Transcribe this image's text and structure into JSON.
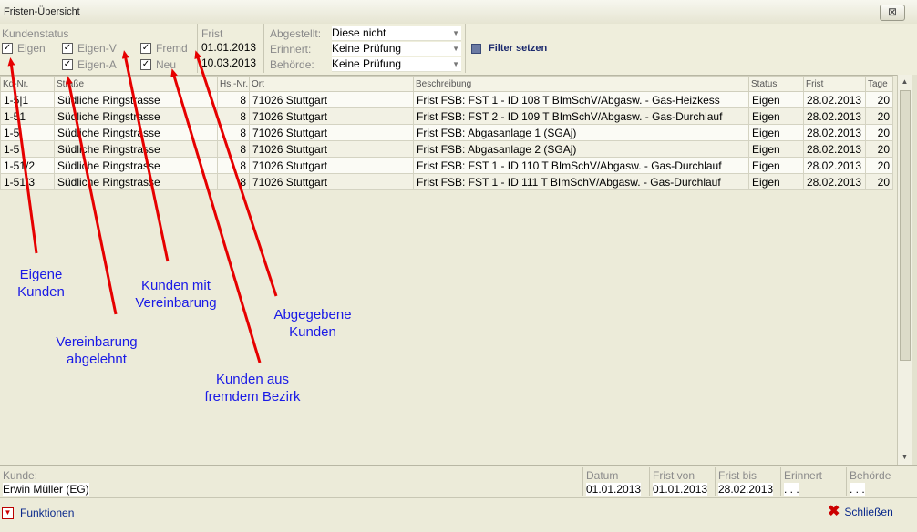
{
  "window": {
    "title": "Fristen-Übersicht",
    "close_label": "⊠"
  },
  "filter": {
    "kundenstatus_label": "Kundenstatus",
    "checkboxes": [
      {
        "label": "Eigen",
        "checked": true
      },
      {
        "label": "Eigen-V",
        "checked": true
      },
      {
        "label": "Fremd",
        "checked": true
      },
      {
        "label": "Eigen-A",
        "checked": true
      },
      {
        "label": "Neu",
        "checked": true
      }
    ],
    "frist_label": "Frist",
    "frist_from": "01.01.2013",
    "frist_to": "10.03.2013",
    "abgestellt_label": "Abgestellt:",
    "abgestellt_value": "Diese nicht",
    "erinnert_label": "Erinnert:",
    "erinnert_value": "Keine Prüfung",
    "behoerde_label": "Behörde:",
    "behoerde_value": "Keine Prüfung",
    "filter_button": "Filter setzen",
    "checkmark": "✓",
    "dropdown_arrow": "▼"
  },
  "table": {
    "columns": [
      "Kd-Nr.",
      "Straße",
      "Hs.-Nr.",
      "Ort",
      "Beschreibung",
      "Status",
      "Frist",
      "Tage"
    ],
    "rows": [
      [
        "1-5|1",
        "Südliche Ringstrasse",
        "8",
        "71026 Stuttgart",
        "Frist FSB: FST 1 - ID 108 T BImSchV/Abgasw. - Gas-Heizkess",
        "Eigen",
        "28.02.2013",
        "20"
      ],
      [
        "1-51",
        "Südliche Ringstrasse",
        "8",
        "71026 Stuttgart",
        "Frist FSB: FST 2 - ID 109 T BImSchV/Abgasw. - Gas-Durchlauf",
        "Eigen",
        "28.02.2013",
        "20"
      ],
      [
        "1-5",
        "Südliche Ringstrasse",
        "8",
        "71026 Stuttgart",
        "Frist FSB: Abgasanlage 1 (SGAj)",
        "Eigen",
        "28.02.2013",
        "20"
      ],
      [
        "1-5",
        "Südliche Ringstrasse",
        "8",
        "71026 Stuttgart",
        "Frist FSB: Abgasanlage 2 (SGAj)",
        "Eigen",
        "28.02.2013",
        "20"
      ],
      [
        "1-51/2",
        "Südliche Ringstrasse",
        "8",
        "71026 Stuttgart",
        "Frist FSB: FST 1 - ID 110 T BImSchV/Abgasw. - Gas-Durchlauf",
        "Eigen",
        "28.02.2013",
        "20"
      ],
      [
        "1-51/3",
        "Südliche Ringstrasse",
        "8",
        "71026 Stuttgart",
        "Frist FSB: FST 1 - ID 111 T BImSchV/Abgasw. - Gas-Durchlauf",
        "Eigen",
        "28.02.2013",
        "20"
      ]
    ]
  },
  "scroll": {
    "up": "▲",
    "down": "▼"
  },
  "bottom": {
    "kunde_label": "Kunde:",
    "kunde_value": "Erwin Müller (EG)",
    "datum_label": "Datum",
    "datum_value": "01.01.2013",
    "frist_von_label": "Frist von",
    "frist_von_value": "01.01.2013",
    "frist_bis_label": "Frist bis",
    "frist_bis_value": "28.02.2013",
    "erinnert_label": "Erinnert",
    "erinnert_value": ". . .",
    "behoerde_label": "Behörde",
    "behoerde_value": ". . ."
  },
  "footer": {
    "funktionen": "Funktionen",
    "funktionen_icon": "▼",
    "close": "Schließen",
    "close_icon": "✖"
  },
  "annotations": [
    {
      "text": "Eigene\nKunden"
    },
    {
      "text": "Vereinbarung\nabgelehnt"
    },
    {
      "text": "Kunden mit\nVereinbarung"
    },
    {
      "text": "Kunden aus\nfremdem Bezirk"
    },
    {
      "text": "Abgegebene\nKunden"
    }
  ],
  "colors": {
    "arrow": "#e60000",
    "annotation": "#1a1ae6",
    "link": "#0b2a8c"
  }
}
